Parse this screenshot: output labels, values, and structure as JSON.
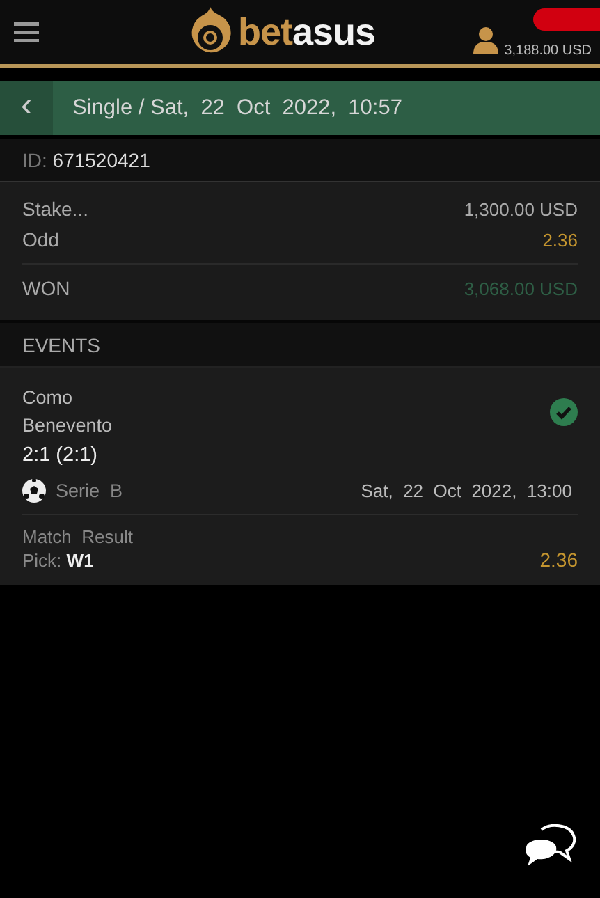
{
  "header": {
    "logo": {
      "part_1": "bet",
      "part_2": "asus"
    },
    "balance": "3,188.00 USD"
  },
  "title_bar": {
    "back": "‹",
    "title": "Single / Sat,  22  Oct  2022,  10:57"
  },
  "bet_id": {
    "label": "ID: ",
    "value": "671520421"
  },
  "summary": [
    {
      "kind": "stake",
      "label": "Stake...",
      "value": "1,300.00 USD"
    },
    {
      "kind": "odd",
      "label": "Odd",
      "value": "2.36"
    },
    {
      "kind": "won",
      "label": "WON",
      "value": "3,068.00 USD"
    }
  ],
  "events_heading": "EVENTS",
  "events": [
    {
      "home": "Como",
      "away": "Benevento",
      "score": "2:1 (2:1)",
      "league": "Serie  B",
      "date": "Sat,  22  Oct  2022,  13:00",
      "kind": "won",
      "market": "Match  Result",
      "pick": "Pick: **W1**",
      "odd": "2.36"
    }
  ]
}
